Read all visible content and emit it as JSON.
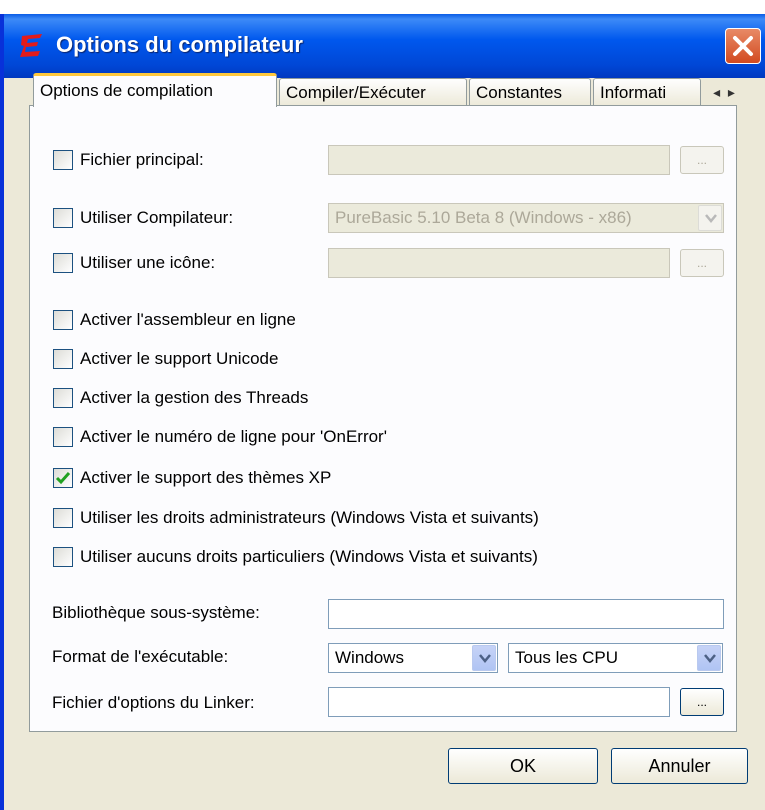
{
  "window": {
    "title": "Options du compilateur"
  },
  "tabs": [
    {
      "label": "Options de compilation",
      "active": true
    },
    {
      "label": "Compiler/Exécuter",
      "active": false
    },
    {
      "label": "Constantes",
      "active": false
    },
    {
      "label": "Informati",
      "active": false
    }
  ],
  "tab_scroll": {
    "left": "◂",
    "right": "▸"
  },
  "fields": {
    "main_file": {
      "label": "Fichier principal:",
      "checked": false,
      "value": "",
      "browse": "..."
    },
    "compiler": {
      "label": "Utiliser Compilateur:",
      "checked": false,
      "value": "PureBasic 5.10 Beta 8 (Windows - x86)"
    },
    "icon": {
      "label": "Utiliser une icône:",
      "checked": false,
      "value": "",
      "browse": "..."
    }
  },
  "options": [
    {
      "label": "Activer l'assembleur en ligne",
      "checked": false
    },
    {
      "label": "Activer le support Unicode",
      "checked": false
    },
    {
      "label": "Activer la gestion des Threads",
      "checked": false
    },
    {
      "label": "Activer le numéro de ligne pour 'OnError'",
      "checked": false
    },
    {
      "label": "Activer le support des thèmes XP",
      "checked": true
    },
    {
      "label": "Utiliser les droits administrateurs (Windows Vista et suivants)",
      "checked": false
    },
    {
      "label": "Utiliser aucuns droits particuliers (Windows Vista et suivants)",
      "checked": false
    }
  ],
  "subsystem": {
    "label": "Bibliothèque sous-système:",
    "value": ""
  },
  "exe_format": {
    "label": "Format de l'exécutable:",
    "format_value": "Windows",
    "cpu_value": "Tous les CPU"
  },
  "linker": {
    "label": "Fichier d'options du Linker:",
    "value": "",
    "browse": "..."
  },
  "buttons": {
    "ok": "OK",
    "cancel": "Annuler"
  },
  "colors": {
    "accent": "#0058ee",
    "check": "#21a121",
    "tab_highlight": "#ffc83c"
  }
}
